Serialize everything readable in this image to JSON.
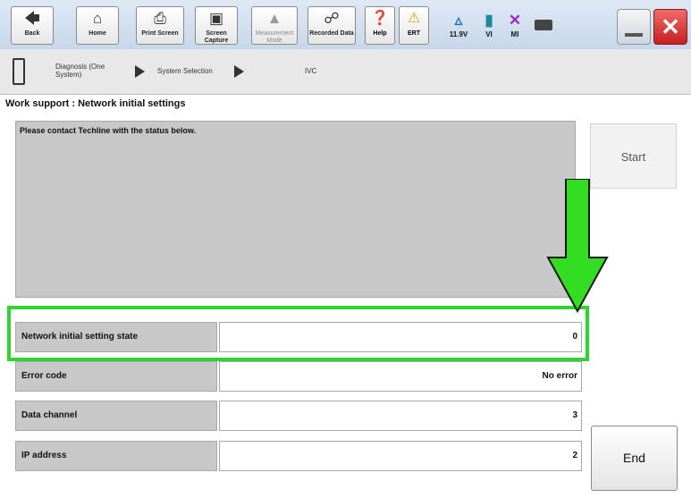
{
  "toolbar": {
    "back_label": "Back",
    "home_label": "Home",
    "print_label": "Print Screen",
    "capture_label": "Screen Capture",
    "measurement_label": "Measurement Mode",
    "recorded_label": "Recorded Data",
    "help_label": "Help",
    "ert_label": "ERT",
    "battery_voltage": "11.9V",
    "vi_label": "VI",
    "mi_label": "MI"
  },
  "breadcrumb": {
    "item1": "Diagnosis (One System)",
    "item2": "System Selection",
    "item3": "IVC"
  },
  "work_support": {
    "title": "Work support : Network initial settings",
    "message": "Please contact Techline with the status below.",
    "start_label": "Start",
    "end_label": "End",
    "rows": [
      {
        "label": "Network initial setting state",
        "value": "0"
      },
      {
        "label": "Error code",
        "value": "No error"
      },
      {
        "label": "Data channel",
        "value": "3"
      },
      {
        "label": "IP address",
        "value": "2"
      }
    ]
  },
  "colors": {
    "highlight": "#2fd42f",
    "arrow": "#33dd22",
    "close_button": "#e04040"
  },
  "icons": [
    "back-icon",
    "home-icon",
    "print-icon",
    "camera-icon",
    "measurement-icon",
    "recorded-data-icon",
    "help-icon",
    "warning-icon",
    "car-icon",
    "signal-icon",
    "mi-x-icon",
    "battery-icon",
    "minimize-icon",
    "close-icon",
    "phone-icon"
  ]
}
